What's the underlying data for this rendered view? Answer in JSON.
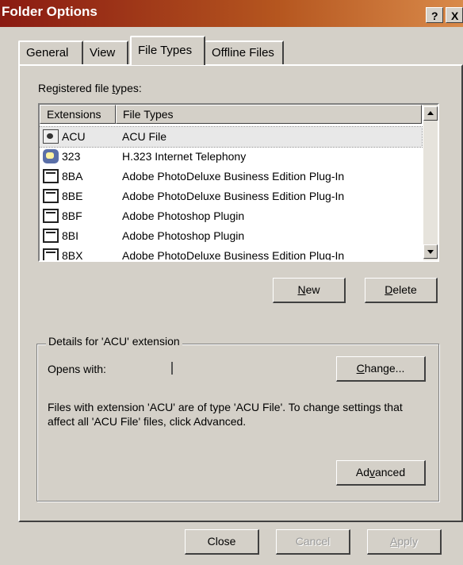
{
  "window": {
    "title": "Folder Options",
    "help_label": "?",
    "close_label": "X"
  },
  "tabs": [
    {
      "label": "General"
    },
    {
      "label": "View"
    },
    {
      "label": "File Types"
    },
    {
      "label": "Offline Files"
    }
  ],
  "registered": {
    "label_pre": "Registered file ",
    "label_accel": "t",
    "label_post": "ypes:"
  },
  "list": {
    "col_extensions": "Extensions",
    "col_file_types": "File Types",
    "rows": [
      {
        "ext": "ACU",
        "type": "ACU File",
        "icon": "document-icon"
      },
      {
        "ext": "323",
        "type": "H.323 Internet Telephony",
        "icon": "phone-icon"
      },
      {
        "ext": "8BA",
        "type": "Adobe PhotoDeluxe Business Edition Plug-In",
        "icon": "plugin-icon"
      },
      {
        "ext": "8BE",
        "type": "Adobe PhotoDeluxe Business Edition Plug-In",
        "icon": "plugin-icon"
      },
      {
        "ext": "8BF",
        "type": "Adobe Photoshop Plugin",
        "icon": "plugin-icon"
      },
      {
        "ext": "8BI",
        "type": "Adobe Photoshop Plugin",
        "icon": "plugin-icon"
      },
      {
        "ext": "8BX",
        "type": "Adobe PhotoDeluxe Business Edition Plug-In",
        "icon": "plugin-icon"
      }
    ]
  },
  "buttons": {
    "new_accel": "N",
    "new_rest": "ew",
    "delete_accel": "D",
    "delete_rest": "elete",
    "change_accel": "C",
    "change_rest": "hange...",
    "advanced_pre": "Ad",
    "advanced_accel": "v",
    "advanced_post": "anced",
    "close": "Close",
    "cancel": "Cancel",
    "apply_accel": "A",
    "apply_rest": "pply"
  },
  "details": {
    "title": "Details for 'ACU' extension",
    "opens_with_label": "Opens with:",
    "description": "Files with extension 'ACU' are of type 'ACU File'.  To change settings that affect all 'ACU File' files, click Advanced."
  }
}
